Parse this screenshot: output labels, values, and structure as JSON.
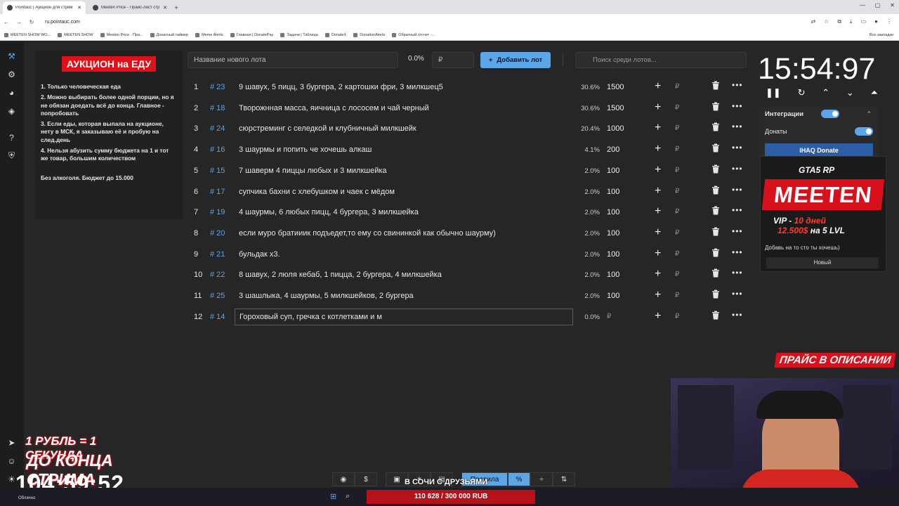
{
  "browser": {
    "tabs": [
      {
        "title": "Pointauc | Аукцион для стрим",
        "active": true
      },
      {
        "title": "Meeten Price - Прайс-лист стр",
        "active": false
      }
    ],
    "url": "ru.pointauc.com",
    "bookmarks": [
      "MEETEN SHOW WO...",
      "MEETEN SHOW",
      "Meeten Price - Пра...",
      "Донатный таймер",
      "Meme Alerts",
      "Главная | DonatePay",
      "Задачи | Таблица",
      "DonateX",
      "DonationAlerts",
      "Обратный отсчет -..."
    ],
    "bookmarks_right": "Все закладки"
  },
  "rules": {
    "title": "АУКЦИОН на ЕДУ",
    "items": [
      "1. Только человеческая еда",
      "2. Можно выбирать более одной порции, но я не обязан доедать всё до конца. Главное - попробовать",
      "3. Если еды, которая выпала на аукционе, нету в МСК, я заказываю её и пробую на след.день",
      "4. Нельзя абузить сумму бюджета на 1 и тот же товар, большим количеством",
      "Без алкоголя. Бюджет до 15.000"
    ]
  },
  "controls": {
    "lot_name_placeholder": "Название нового лота",
    "lot_pct": "0.0%",
    "amount_placeholder": "₽",
    "add_label": "Добавить лот",
    "search_placeholder": "Поиск среди лотов..."
  },
  "lots": [
    {
      "num": "1",
      "id": "# 23",
      "name": "9 шавух, 5 пицц, 3 бургера, 2 картошки фри, 3 милкшец5",
      "pct": "30.6%",
      "amount": "1500"
    },
    {
      "num": "2",
      "id": "# 18",
      "name": "Творожнная масса, яичница с лососем и чай черный",
      "pct": "30.6%",
      "amount": "1500"
    },
    {
      "num": "3",
      "id": "# 24",
      "name": "сюрстреминг с селедкой и клубничный милкшейк",
      "pct": "20.4%",
      "amount": "1000"
    },
    {
      "num": "4",
      "id": "# 16",
      "name": "3 шаурмы и попить че хочешь алкаш",
      "pct": "4.1%",
      "amount": "200"
    },
    {
      "num": "5",
      "id": "# 15",
      "name": "7 шаверм 4 пиццы любых и 3 милкшейка",
      "pct": "2.0%",
      "amount": "100"
    },
    {
      "num": "6",
      "id": "# 17",
      "name": " супчика бахни с хлебушком и чаек с мёдом",
      "pct": "2.0%",
      "amount": "100"
    },
    {
      "num": "7",
      "id": "# 19",
      "name": "4 шаурмы, 6 любых пицц, 4 бургера, 3 милкшейка",
      "pct": "2.0%",
      "amount": "100"
    },
    {
      "num": "8",
      "id": "# 20",
      "name": "если муро братииик подъедет,то ему со свининкой как обычно шаурму)",
      "pct": "2.0%",
      "amount": "100"
    },
    {
      "num": "9",
      "id": "# 21",
      "name": " бульдак х3.",
      "pct": "2.0%",
      "amount": "100"
    },
    {
      "num": "10",
      "id": "# 22",
      "name": "8 шавух, 2 люля кебаб, 1 пицца, 2 бургера, 4 милкшейка",
      "pct": "2.0%",
      "amount": "100"
    },
    {
      "num": "11",
      "id": "# 25",
      "name": "3 шашлыка, 4 шаурмы, 5 милкшейков, 2 бургера",
      "pct": "2.0%",
      "amount": "100"
    },
    {
      "num": "12",
      "id": "# 14",
      "name": "Гороховый суп, гречка с котлетками и м",
      "pct": "0.0%",
      "amount": "₽"
    }
  ],
  "rub_sign": "₽",
  "timer": "15:54:97",
  "integrations": {
    "label": "Интеграции",
    "donations": "Донаты",
    "ihaq": "IHAQ Donate"
  },
  "ad": {
    "gta": "GTA5 RP",
    "brand": "MEETEN",
    "vip_a": "VIP - ",
    "vip_b": "10 дней",
    "vip_c": "12.500$",
    "vip_d": " на 5 LVL",
    "hint": "Добавь на то сто ты хочешь)",
    "select": "Новый"
  },
  "price_banner": "ПРАЙС В ОПИСАНИИ",
  "donation_overlay": {
    "line1": "1 РУБЛЬ = 1 СЕКУНДА",
    "line2": "ДО КОНЦА СТРИМА",
    "timer": "104:59:52"
  },
  "toolbar": {
    "rules_label": "Правила"
  },
  "goal": {
    "caption": "В СОЧИ С ДРУЗЬЯМИ",
    "value": "110 628 / 300 000 RUB"
  },
  "weather": "Облачно"
}
